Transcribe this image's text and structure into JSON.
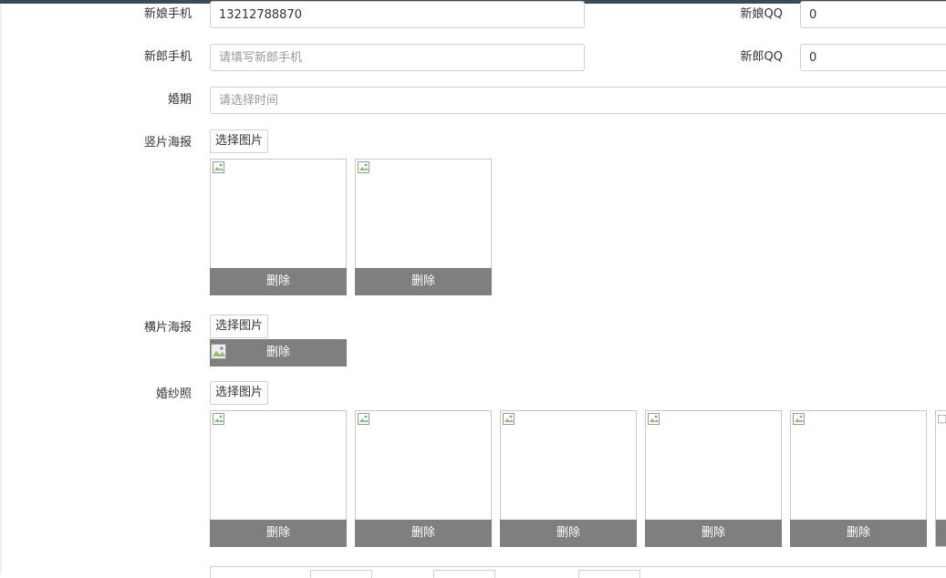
{
  "form": {
    "bride_phone": {
      "label": "新娘手机",
      "value": "13212788870"
    },
    "bride_qq": {
      "label": "新娘QQ",
      "value": "0"
    },
    "groom_phone": {
      "label": "新郎手机",
      "placeholder": "请填写新郎手机"
    },
    "groom_qq": {
      "label": "新郎QQ",
      "value": "0"
    },
    "wedding_date": {
      "label": "婚期",
      "placeholder": "请选择时间"
    },
    "vertical_poster": {
      "label": "竖片海报",
      "select_label": "选择图片",
      "delete_label": "删除",
      "image_count": 2
    },
    "horizontal_poster": {
      "label": "横片海报",
      "select_label": "选择图片",
      "delete_label": "删除"
    },
    "wedding_photos": {
      "label": "婚纱照",
      "select_label": "选择图片",
      "delete_label": "删除",
      "image_count": 6
    }
  }
}
